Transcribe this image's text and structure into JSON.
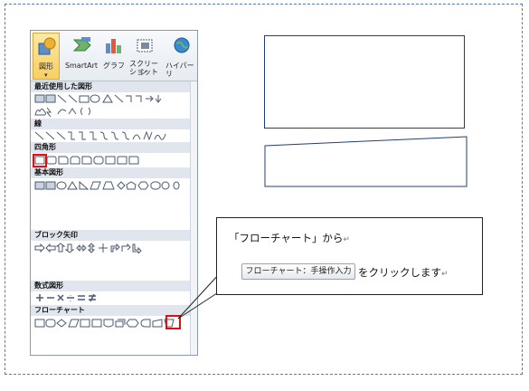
{
  "ribbon": {
    "shapes_label": "図形",
    "smartart_label": "SmartArt",
    "chart_label": "グラフ",
    "screenshot_label_1": "スクリーン",
    "screenshot_label_2": "ショット",
    "hyperlink_label": "ハイパーリ"
  },
  "sections": {
    "recent": "最近使用した図形",
    "lines": "線",
    "rectangles": "四角形",
    "basic": "基本図形",
    "arrows": "ブロック矢印",
    "equation": "数式図形",
    "flowchart": "フローチャート"
  },
  "callout": {
    "line1": "「フローチャート」から",
    "line2": "をクリックします",
    "return_mark": "↵"
  },
  "tooltip": {
    "text": "フローチャート：手操作入力"
  },
  "colors": {
    "accent_red": "#e01010",
    "frame_blue": "#5a7bb0",
    "shape_blue": "#1f3f7a",
    "icon_gray": "#4a5a70"
  }
}
